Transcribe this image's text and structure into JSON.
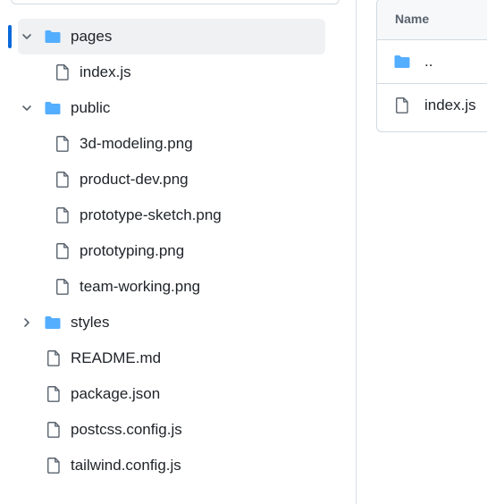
{
  "file_tree": {
    "items": [
      {
        "name": "pages",
        "type": "folder",
        "expanded": true,
        "selected": true
      },
      {
        "name": "index.js",
        "type": "file"
      },
      {
        "name": "public",
        "type": "folder",
        "expanded": true
      },
      {
        "name": "3d-modeling.png",
        "type": "file"
      },
      {
        "name": "product-dev.png",
        "type": "file"
      },
      {
        "name": "prototype-sketch.png",
        "type": "file"
      },
      {
        "name": "prototyping.png",
        "type": "file"
      },
      {
        "name": "team-working.png",
        "type": "file"
      },
      {
        "name": "styles",
        "type": "folder",
        "expanded": false
      },
      {
        "name": "README.md",
        "type": "file"
      },
      {
        "name": "package.json",
        "type": "file"
      },
      {
        "name": "postcss.config.js",
        "type": "file"
      },
      {
        "name": "tailwind.config.js",
        "type": "file"
      }
    ]
  },
  "file_list": {
    "header": {
      "name_label": "Name"
    },
    "rows": [
      {
        "name": "..",
        "type": "folder"
      },
      {
        "name": "index.js",
        "type": "file"
      }
    ]
  },
  "colors": {
    "accent": "#0969da",
    "folder": "#54aeff",
    "selected_bg": "#eff1f3",
    "text": "#1f2328",
    "muted": "#59636e",
    "border": "#d1d9e0"
  },
  "icons": {
    "folder": "folder-icon",
    "file": "file-icon",
    "chevron_down": "chevron-down-icon",
    "chevron_right": "chevron-right-icon"
  }
}
